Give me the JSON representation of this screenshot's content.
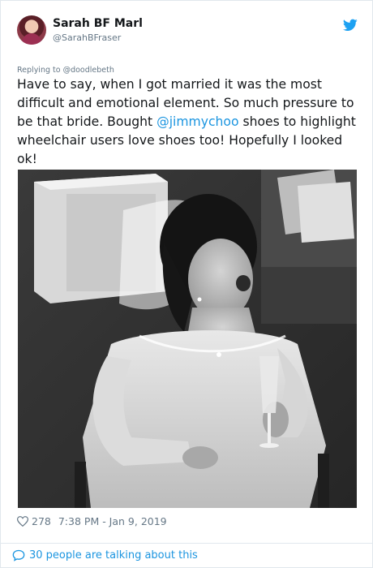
{
  "user": {
    "display_name": "Sarah BF Marl",
    "handle": "@SarahBFraser"
  },
  "reply": {
    "prefix": "Replying to",
    "target": "@doodlebeth"
  },
  "tweet": {
    "text_before": "Have to say, when I got married it was the most difficult and emotional element. So much pressure to be that bride. Bought ",
    "mention": "@jimmychoo",
    "text_after": " shoes to highlight wheelchair users love shoes too! Hopefully I looked ok!"
  },
  "meta": {
    "likes": "278",
    "timestamp": "7:38 PM - Jan 9, 2019"
  },
  "footer": {
    "talking": "30 people are talking about this"
  },
  "icons": {
    "brand": "twitter-bird-icon",
    "like": "heart-icon",
    "reply": "speech-bubble-icon"
  },
  "colors": {
    "accent": "#1b95e0",
    "muted": "#657786",
    "text": "#14171a",
    "brand": "#1da1f2"
  }
}
